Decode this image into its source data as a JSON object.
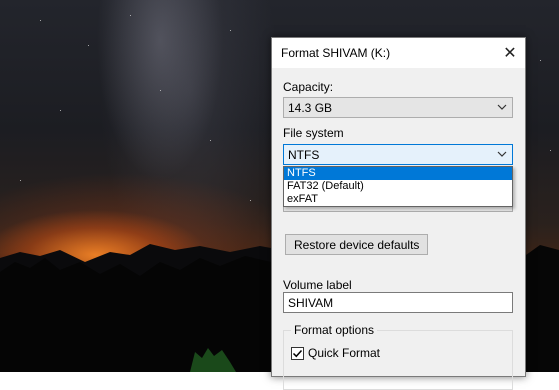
{
  "dialog": {
    "title": "Format SHIVAM (K:)",
    "close_symbol": "✕"
  },
  "capacity": {
    "label": "Capacity:",
    "value": "14.3 GB"
  },
  "file_system": {
    "label": "File system",
    "value": "NTFS",
    "options": [
      "NTFS",
      "FAT32 (Default)",
      "exFAT"
    ],
    "selected_index": 0
  },
  "restore_button": {
    "label": "Restore device defaults"
  },
  "volume_label": {
    "label": "Volume label",
    "value": "SHIVAM"
  },
  "format_options": {
    "legend": "Format options",
    "quick_format_label": "Quick Format",
    "quick_format_checked": true
  },
  "icons": {
    "close": "close-icon",
    "dropdown": "chevron-down-icon",
    "check": "checkmark-icon"
  },
  "colors": {
    "selection": "#0078d7",
    "dialog_bg": "#f0f0f0"
  }
}
